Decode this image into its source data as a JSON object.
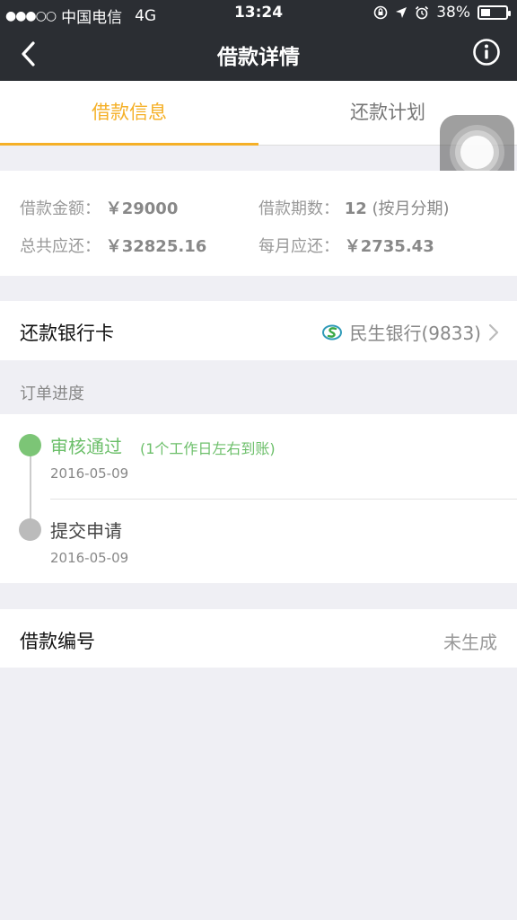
{
  "status_bar": {
    "signal_dots": "●●●○○",
    "carrier": "中国电信",
    "network": "4G",
    "time": "13:24",
    "battery_percent": "38%",
    "battery_level": 0.38
  },
  "nav": {
    "title": "借款详情",
    "back_icon": "chevron-left-icon",
    "info_icon": "info-circle-icon"
  },
  "tabs": [
    {
      "label": "借款信息",
      "active": true
    },
    {
      "label": "还款计划",
      "active": false
    }
  ],
  "loan_info": {
    "amount_label": "借款金额：",
    "amount_value": "￥29000",
    "term_label": "借款期数：",
    "term_value": "12",
    "term_suffix": "(按月分期)",
    "total_label": "总共应还：",
    "total_value": "￥32825.16",
    "monthly_label": "每月应还：",
    "monthly_value": "￥2735.43"
  },
  "bank_card": {
    "label": "还款银行卡",
    "bank_name": "民生银行(9833)",
    "bank_icon": "minsheng-bank-logo-icon"
  },
  "order_progress": {
    "header": "订单进度",
    "steps": [
      {
        "title": "审核通过",
        "note": "(1个工作日左右到账)",
        "date": "2016-05-09",
        "status": "done"
      },
      {
        "title": "提交申请",
        "note": "",
        "date": "2016-05-09",
        "status": "past"
      }
    ]
  },
  "loan_number": {
    "label": "借款编号",
    "value": "未生成"
  },
  "colors": {
    "nav_bg": "#2b2e33",
    "accent": "#f5b027",
    "success": "#6cbf6a"
  }
}
